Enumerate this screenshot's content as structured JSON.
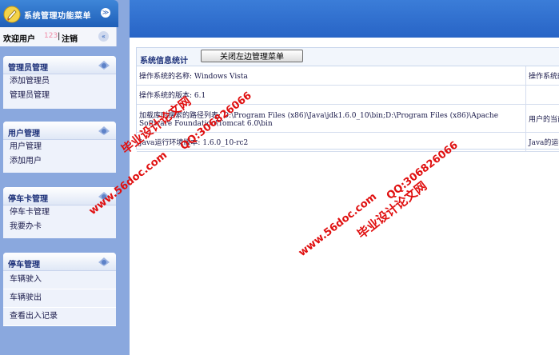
{
  "sidebar": {
    "header_title": "系统管理功能菜单",
    "header_toggle": "≫",
    "welcome": "欢迎用户",
    "user_number": "123",
    "separator": "|",
    "logout": "注销",
    "collapse": "«",
    "panels": [
      {
        "title": "管理员管理",
        "items": [
          "添加管理员",
          "管理员管理"
        ]
      },
      {
        "title": "用户管理",
        "items": [
          "用户管理",
          "添加用户"
        ]
      },
      {
        "title": "停车卡管理",
        "items": [
          "停车卡管理",
          "我要办卡"
        ]
      },
      {
        "title": "停车管理",
        "items": [
          "车辆驶入",
          "车辆驶出",
          "查看出入记录"
        ]
      }
    ]
  },
  "main": {
    "section_title": "系统信息统计",
    "close_button": "关闭左边管理菜单",
    "rows": [
      {
        "left": "操作系统的名称:    Windows Vista",
        "right": "操作系统的"
      },
      {
        "left": "操作系统的版本:    6.1",
        "right": ""
      },
      {
        "left": "加载库时搜索的路径列表:    D:\\Program Files (x86)\\Java\\jdk1.6.0_10\\bin;D:\\Program Files (x86)\\Apache Software Foundation\\Tomcat 6.0\\bin",
        "right": "用户的当前"
      },
      {
        "left": "Java运行环境版本:    1.6.0_10-rc2",
        "right": "Java的运行"
      }
    ]
  },
  "watermarks": [
    {
      "text": "毕业设计论文网"
    },
    {
      "text": "www.56doc.com"
    },
    {
      "text": "QQ:306826066"
    },
    {
      "text": "www.56doc.com"
    },
    {
      "text": "QQ:306826066"
    },
    {
      "text": "毕业设计论文网"
    }
  ],
  "colors": {
    "sidebar_bg": "#8aa8de",
    "header_blue": "#2864c6",
    "watermark_red": "#e01010"
  }
}
